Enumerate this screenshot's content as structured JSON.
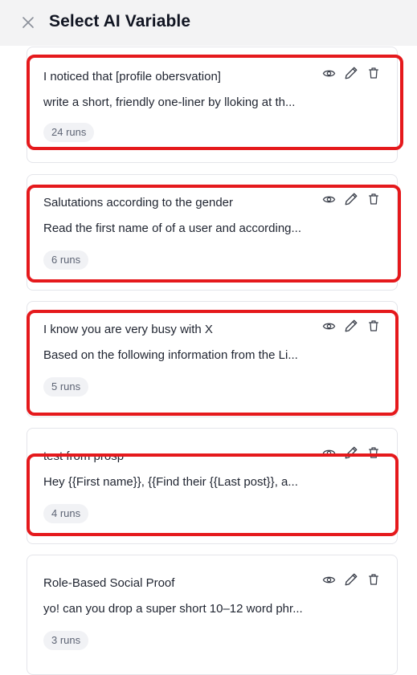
{
  "header": {
    "title": "Select AI Variable",
    "close_icon": "close-icon"
  },
  "cards": [
    {
      "title": "I noticed that [profile obersvation]",
      "description": "write a short, friendly one-liner by lloking at th...",
      "runs": "24 runs"
    },
    {
      "title": "Salutations according to the gender",
      "description": "Read the first name of of a user and according...",
      "runs": "6 runs"
    },
    {
      "title": "I know you are very busy with X",
      "description": "Based on the following information from the Li...",
      "runs": "5 runs"
    },
    {
      "title": "test from prosp",
      "description": "Hey {{First name}}, {{Find their {{Last post}}, a...",
      "runs": "4 runs"
    },
    {
      "title": "Role-Based Social Proof",
      "description": "yo! can you drop a super short 10–12 word phr...",
      "runs": "3 runs"
    }
  ],
  "icons": {
    "view": "eye-icon",
    "edit": "pencil-icon",
    "delete": "trash-icon"
  },
  "colors": {
    "highlight": "#e5191c",
    "header_bg": "#f3f3f4",
    "badge_bg": "#f1f2f5"
  }
}
